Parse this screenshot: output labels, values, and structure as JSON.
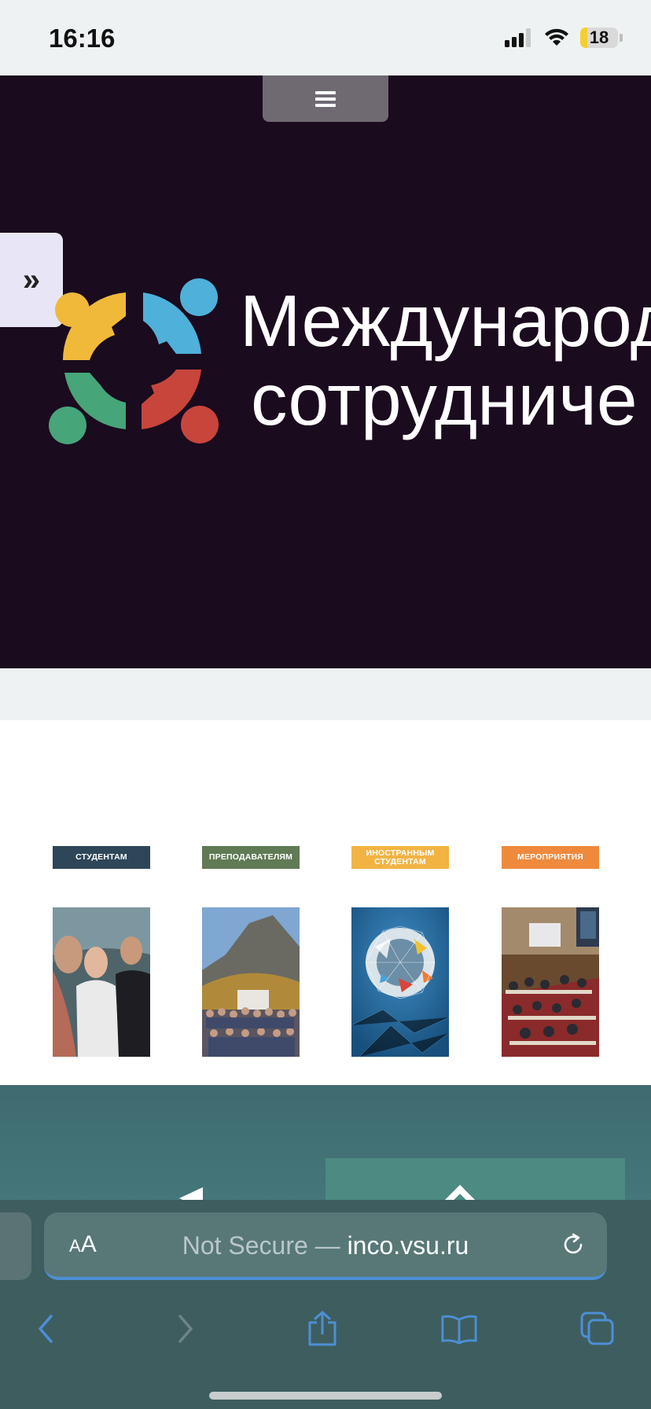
{
  "status": {
    "time": "16:16",
    "battery_level": "18",
    "battery_fraction": 0.18,
    "signal_icon": "signal-bars-icon",
    "wifi_icon": "wifi-icon"
  },
  "hero": {
    "title_line1": "Международ",
    "title_line2": "сотрудниче",
    "menu_icon": "hamburger-menu-icon",
    "side_toggle": "»",
    "background_color": "#1a0b1e",
    "logo_colors": [
      "#f0b93a",
      "#4fb0d9",
      "#47a57a",
      "#c8453b"
    ]
  },
  "cards": [
    {
      "label": "СТУДЕНТАМ",
      "color": "#2e4658",
      "photo": "students-selfie-photo"
    },
    {
      "label": "ПРЕПОДАВАТЕЛЯМ",
      "color": "#5f7a55",
      "photo": "group-mountain-photo"
    },
    {
      "label": "ИНОСТРАННЫМ СТУДЕНТАМ",
      "color": "#f2b343",
      "photo": "globe-network-photo"
    },
    {
      "label": "МЕРОПРИЯТИЯ",
      "color": "#ef8a3d",
      "photo": "conference-hall-photo"
    }
  ],
  "browser": {
    "aa_label_small": "A",
    "aa_label_large": "A",
    "url_prefix": "Not Secure — ",
    "url_domain": "inco.vsu.ru",
    "accent_color": "#4c8fd6",
    "toolbar_icons": [
      "back-icon",
      "forward-icon",
      "share-icon",
      "bookmarks-icon",
      "tabs-icon"
    ]
  }
}
